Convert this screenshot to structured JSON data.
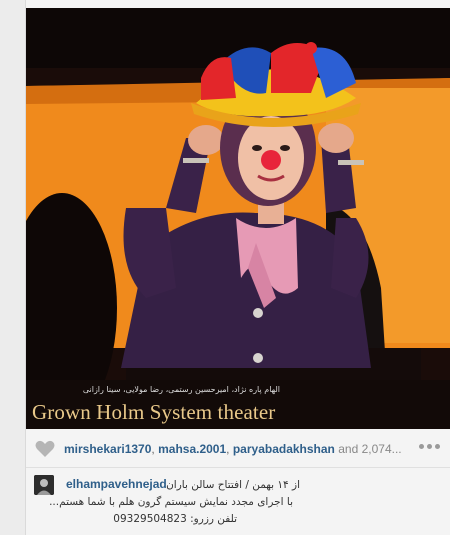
{
  "photo": {
    "credits_overlay": "الهام پاره نژاد، امیرحسین رستمی، رضا مولایی، سینا رازانی",
    "title_overlay": "Grown Holm System theater"
  },
  "likes": {
    "users": [
      "mirshekari1370",
      "mahsa.2001",
      "paryabadakhshan"
    ],
    "separator": ",",
    "more_text": "and 2,074..."
  },
  "icons": {
    "like": "heart-icon",
    "more": "more-dots-icon",
    "avatar": "user-avatar"
  },
  "comment": {
    "username": "elhampavehnejad",
    "lines": [
      "از ۱۴ بهمن / افتتاح سالن باران",
      "با اجرای مجدد نمایش سیستم گرون هلم با شما هستم...",
      "تلفن رزرو: 09329504823"
    ]
  },
  "colors": {
    "link": "#2f5f8a",
    "background": "#f4f4f4",
    "stage_orange": "#f08a1c"
  }
}
